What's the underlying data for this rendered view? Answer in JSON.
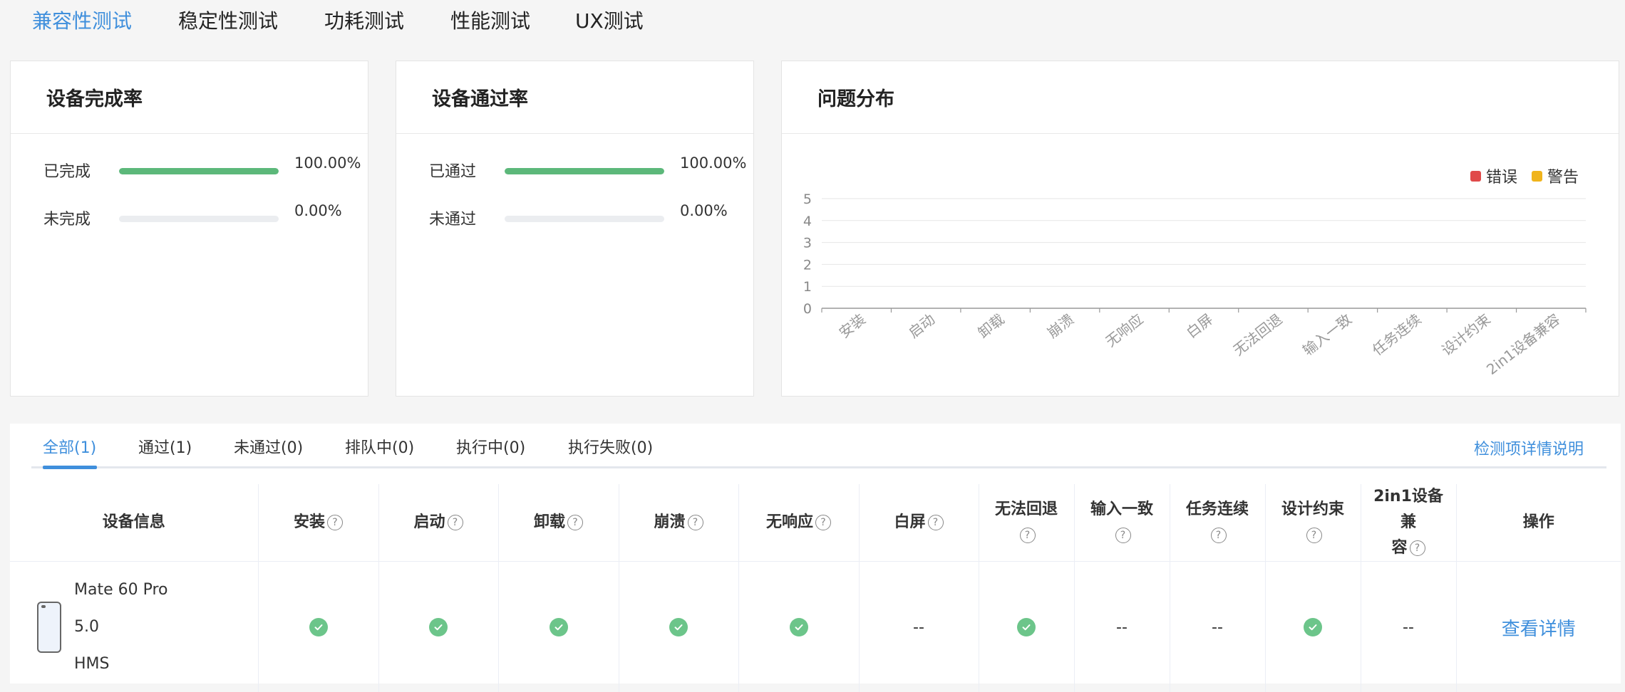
{
  "top_tabs": [
    {
      "label": "兼容性测试",
      "active": true
    },
    {
      "label": "稳定性测试",
      "active": false
    },
    {
      "label": "功耗测试",
      "active": false
    },
    {
      "label": "性能测试",
      "active": false
    },
    {
      "label": "UX测试",
      "active": false
    }
  ],
  "completion_card": {
    "title": "设备完成率",
    "rows": [
      {
        "label": "已完成",
        "percent": "100.00%",
        "fraction": 1.0
      },
      {
        "label": "未完成",
        "percent": "0.00%",
        "fraction": 0.0
      }
    ]
  },
  "pass_card": {
    "title": "设备通过率",
    "rows": [
      {
        "label": "已通过",
        "percent": "100.00%",
        "fraction": 1.0
      },
      {
        "label": "未通过",
        "percent": "0.00%",
        "fraction": 0.0
      }
    ]
  },
  "issues_card": {
    "title": "问题分布"
  },
  "chart_data": {
    "type": "bar",
    "categories": [
      "安装",
      "启动",
      "卸载",
      "崩溃",
      "无响应",
      "白屏",
      "无法回退",
      "输入一致",
      "任务连续",
      "设计约束",
      "2in1设备兼容"
    ],
    "series": [
      {
        "name": "错误",
        "color": "#e04a4a",
        "values": [
          0,
          0,
          0,
          0,
          0,
          0,
          0,
          0,
          0,
          0,
          0
        ]
      },
      {
        "name": "警告",
        "color": "#f0b41c",
        "values": [
          0,
          0,
          0,
          0,
          0,
          0,
          0,
          0,
          0,
          0,
          0
        ]
      }
    ],
    "yticks": [
      "0",
      "1",
      "2",
      "3",
      "4",
      "5"
    ],
    "ylim": [
      0,
      5
    ],
    "grid": true,
    "legend": "top-right"
  },
  "sub_tabs": [
    {
      "label": "全部(1)",
      "active": true
    },
    {
      "label": "通过(1)",
      "active": false
    },
    {
      "label": "未通过(0)",
      "active": false
    },
    {
      "label": "排队中(0)",
      "active": false
    },
    {
      "label": "执行中(0)",
      "active": false
    },
    {
      "label": "执行失败(0)",
      "active": false
    }
  ],
  "detail_link": "检测项详情说明",
  "table": {
    "headers": {
      "device": "设备信息",
      "install": "安装",
      "launch": "启动",
      "uninstall": "卸载",
      "crash": "崩溃",
      "no_response": "无响应",
      "white_screen": "白屏",
      "no_back_line1": "无法回退",
      "input_consistency": "输入一致",
      "task_continuity": "任务连续",
      "design_constraint": "设计约束",
      "compat_2in1_line1": "2in1设备兼",
      "compat_2in1_line2": "容",
      "action": "操作"
    },
    "help_icon": "?",
    "rows": [
      {
        "device_model": "Mate 60 Pro",
        "device_version": "5.0",
        "device_os": "HMS",
        "results": [
          "pass",
          "pass",
          "pass",
          "pass",
          "pass",
          "--",
          "pass",
          "--",
          "--",
          "pass",
          "--"
        ],
        "empty_text": "--",
        "action_label": "查看详情"
      }
    ]
  },
  "colors": {
    "accent": "#3f8fdc",
    "progress": "#5cb87a",
    "pass": "#6cc58a"
  }
}
